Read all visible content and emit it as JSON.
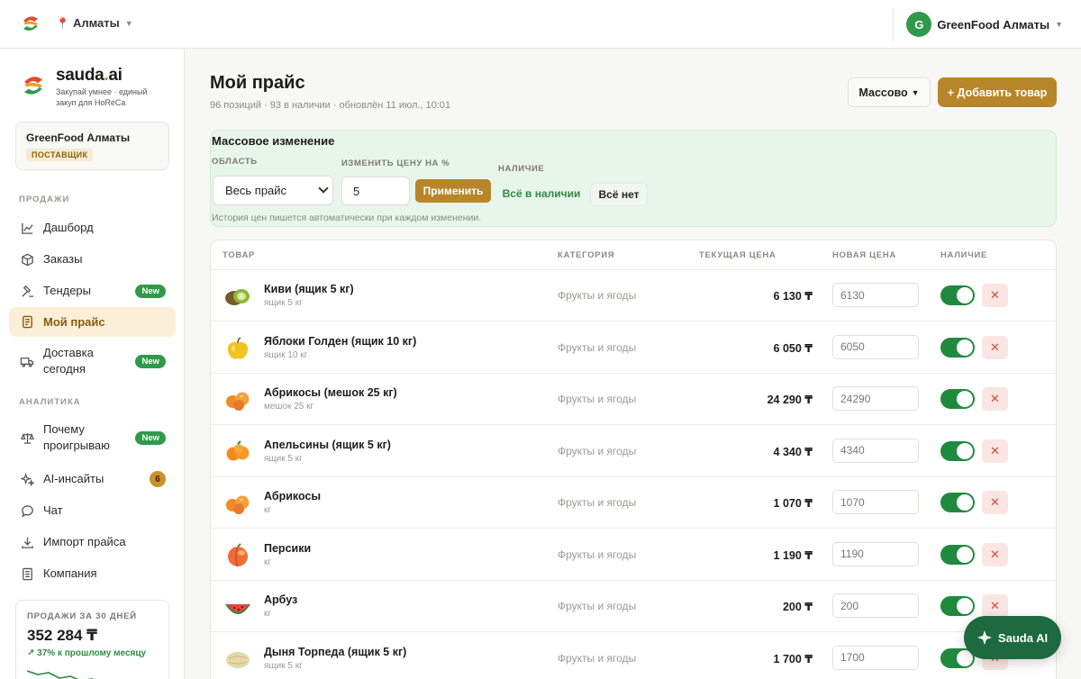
{
  "topbar": {
    "city": "Алматы",
    "account_initial": "G",
    "account_name": "GreenFood Алматы"
  },
  "brand": {
    "name_main": "sauda",
    "name_dot": ".",
    "name_suffix": "ai",
    "tagline": "Закупай умнее · единый закуп для HoReCa"
  },
  "org": {
    "name": "GreenFood Алматы",
    "role": "ПОСТАВЩИК"
  },
  "sidebar": {
    "section_sales": "ПРОДАЖИ",
    "section_analytics": "АНАЛИТИКА",
    "items": [
      {
        "label": "Дашборд"
      },
      {
        "label": "Заказы"
      },
      {
        "label": "Тендеры",
        "badge": "New"
      },
      {
        "label": "Мой прайс"
      },
      {
        "label": "Доставка сегодня",
        "badge": "New"
      },
      {
        "label": "Почему проигрываю",
        "badge": "New"
      },
      {
        "label": "AI-инсайты",
        "count": "6"
      },
      {
        "label": "Чат"
      },
      {
        "label": "Импорт прайса"
      },
      {
        "label": "Компания"
      }
    ],
    "sales_card": {
      "title": "ПРОДАЖИ ЗА 30 ДНЕЙ",
      "value": "352 284 ₸",
      "delta": "↗ 37% к прошлому месяцу"
    }
  },
  "main": {
    "title": "Мой прайс",
    "subtitle": "96 позиций · 93 в наличии · обновлён 11 июл., 10:01",
    "mass_button": "Массово",
    "add_button": "+ Добавить товар"
  },
  "bulk": {
    "title": "Массовое изменение",
    "area_label": "ОБЛАСТЬ",
    "area_value": "Весь прайс",
    "change_label": "ИЗМЕНИТЬ ЦЕНУ НА %",
    "change_value": "5",
    "apply_label": "Применить",
    "stock_label": "НАЛИЧИЕ",
    "all_in": "Всё в наличии",
    "all_out": "Всё нет",
    "note": "История цен пишется автоматически при каждом изменении."
  },
  "table": {
    "columns": {
      "product": "ТОВАР",
      "category": "КАТЕГОРИЯ",
      "current_price": "ТЕКУЩАЯ ЦЕНА",
      "new_price": "НОВАЯ ЦЕНА",
      "stock": "НАЛИЧИЕ"
    },
    "rows": [
      {
        "name": "Киви (ящик 5 кг)",
        "unit": "ящик 5 кг",
        "category": "Фрукты и ягоды",
        "price": "6 130 ₸",
        "new_price": "6130",
        "icon": "kiwi-icon"
      },
      {
        "name": "Яблоки Голден (ящик 10 кг)",
        "unit": "ящик 10 кг",
        "category": "Фрукты и ягоды",
        "price": "6 050 ₸",
        "new_price": "6050",
        "icon": "apple-icon"
      },
      {
        "name": "Абрикосы (мешок 25 кг)",
        "unit": "мешок 25 кг",
        "category": "Фрукты и ягоды",
        "price": "24 290 ₸",
        "new_price": "24290",
        "icon": "apricot-icon"
      },
      {
        "name": "Апельсины (ящик 5 кг)",
        "unit": "ящик 5 кг",
        "category": "Фрукты и ягоды",
        "price": "4 340 ₸",
        "new_price": "4340",
        "icon": "orange-icon"
      },
      {
        "name": "Абрикосы",
        "unit": "кг",
        "category": "Фрукты и ягоды",
        "price": "1 070 ₸",
        "new_price": "1070",
        "icon": "apricot-icon"
      },
      {
        "name": "Персики",
        "unit": "кг",
        "category": "Фрукты и ягоды",
        "price": "1 190 ₸",
        "new_price": "1190",
        "icon": "peach-icon"
      },
      {
        "name": "Арбуз",
        "unit": "кг",
        "category": "Фрукты и ягоды",
        "price": "200 ₸",
        "new_price": "200",
        "icon": "watermelon-icon"
      },
      {
        "name": "Дыня Торпеда (ящик 5 кг)",
        "unit": "ящик 5 кг",
        "category": "Фрукты и ягоды",
        "price": "1 700 ₸",
        "new_price": "1700",
        "icon": "melon-icon"
      }
    ]
  },
  "fab": {
    "label": "Sauda AI"
  },
  "colors": {
    "accent": "#b8862a",
    "green": "#1f8a3e",
    "bulk_bg": "#e8f5ea"
  }
}
